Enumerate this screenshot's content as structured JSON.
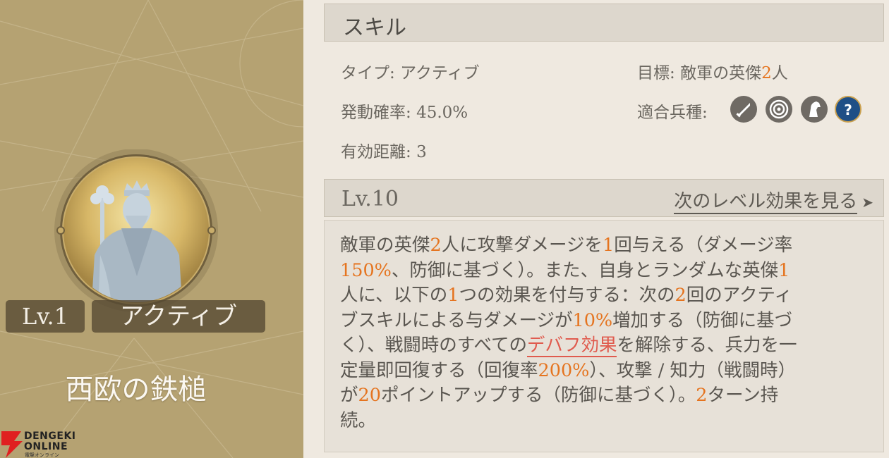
{
  "skill": {
    "name": "西欧の鉄槌",
    "level_badge": "Lv.1",
    "type_badge": "アクティブ"
  },
  "details": {
    "section_title": "スキル",
    "type": {
      "label": "タイプ:",
      "value": "アクティブ"
    },
    "activation_rate": {
      "label": "発動確率:",
      "value": "45.0%"
    },
    "range": {
      "label": "有効距離:",
      "value": "3"
    },
    "target": {
      "label": "目標:",
      "value_prefix": "敵軍の英傑",
      "value_num": "2",
      "value_suffix": "人"
    },
    "troop_types": {
      "label": "適合兵種:",
      "icons": [
        "sword-icon",
        "target-icon",
        "horse-icon",
        "question-icon"
      ]
    }
  },
  "level_section": {
    "title": "Lv.10",
    "next_link": "次のレベル効果を見る"
  },
  "description": {
    "segments": [
      {
        "t": "敵軍の英傑",
        "s": "n"
      },
      {
        "t": "2",
        "s": "hl"
      },
      {
        "t": "人に攻撃ダメージを",
        "s": "n"
      },
      {
        "t": "1",
        "s": "hl"
      },
      {
        "t": "回与える（ダメージ率\n",
        "s": "n"
      },
      {
        "t": "150%",
        "s": "hl"
      },
      {
        "t": "、防御に基づく）。また、自身とランダムな英傑",
        "s": "n"
      },
      {
        "t": "1",
        "s": "hl"
      },
      {
        "t": "\n人に、以下の",
        "s": "n"
      },
      {
        "t": "1",
        "s": "hl"
      },
      {
        "t": "つの効果を付与する：次の",
        "s": "n"
      },
      {
        "t": "2",
        "s": "hl"
      },
      {
        "t": "回のアクティ\nブスキルによる与ダメージが",
        "s": "n"
      },
      {
        "t": "10%",
        "s": "hl"
      },
      {
        "t": "増加する（防御に基づ\nく）、戦闘時のすべての",
        "s": "n"
      },
      {
        "t": "デバフ効果",
        "s": "link"
      },
      {
        "t": "を解除する、兵力を一\n定量即回復する（回復率",
        "s": "n"
      },
      {
        "t": "200%",
        "s": "hl"
      },
      {
        "t": "）、攻撃 / 知力（戦闘時）\nが",
        "s": "n"
      },
      {
        "t": "20",
        "s": "hl"
      },
      {
        "t": "ポイントアップする（防御に基づく）。",
        "s": "n"
      },
      {
        "t": "2",
        "s": "hl"
      },
      {
        "t": "ターン持\n続。",
        "s": "n"
      }
    ]
  },
  "watermark": {
    "line1": "DENGEKI",
    "line2": "ONLINE",
    "sub": "電撃オンライン"
  },
  "colors": {
    "accent": "#e5741f",
    "link": "#e05b4e",
    "panel": "#b5a272",
    "background": "#efe9e0"
  }
}
